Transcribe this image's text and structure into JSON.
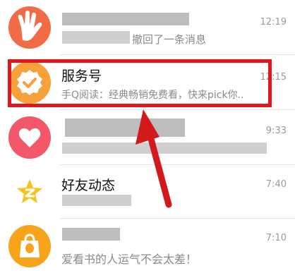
{
  "conversations": [
    {
      "id": "group-chat",
      "avatar": "hand-gesture-icon",
      "avatar_color": "#f26b47",
      "title": "",
      "preview": "撤回了一条消息",
      "time": "12:19",
      "redacted": true
    },
    {
      "id": "service-account",
      "avatar": "badge-check-icon",
      "avatar_color": "#f6a13a",
      "title": "服务号",
      "preview": "手Q阅读：经典畅销免费看，快来pick你..",
      "time": "12:15",
      "highlighted": true
    },
    {
      "id": "special-care",
      "avatar": "heart-icon",
      "avatar_color": "#f2576a",
      "title": "",
      "preview": "",
      "time": "9:33",
      "redacted": true
    },
    {
      "id": "friend-feed",
      "avatar": "qzone-star-icon",
      "avatar_color": "#f7c21a",
      "title": "好友动态",
      "preview": "",
      "time": "7:40"
    },
    {
      "id": "reading",
      "avatar": "shopping-bag-icon",
      "avatar_color": "#f7a31c",
      "title": "",
      "preview": "爱看书的人运气不会太差！",
      "time": "7:10",
      "redacted": true
    }
  ],
  "annotation": {
    "box_color": "#e0171d",
    "arrow_color": "#d4191c"
  }
}
